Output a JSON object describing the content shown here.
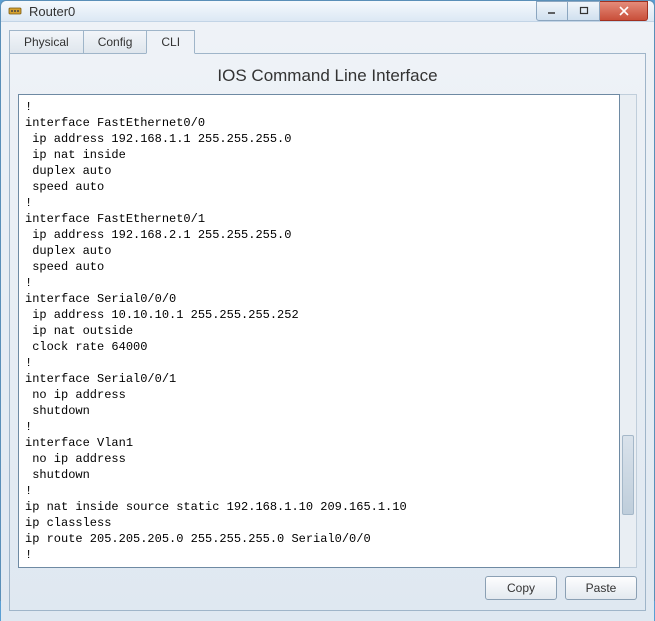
{
  "window": {
    "title": "Router0"
  },
  "tabs": {
    "items": [
      {
        "label": "Physical",
        "active": false
      },
      {
        "label": "Config",
        "active": false
      },
      {
        "label": "CLI",
        "active": true
      }
    ]
  },
  "cli": {
    "heading": "IOS Command Line Interface",
    "lines": [
      "!",
      "interface FastEthernet0/0",
      " ip address 192.168.1.1 255.255.255.0",
      " ip nat inside",
      " duplex auto",
      " speed auto",
      "!",
      "interface FastEthernet0/1",
      " ip address 192.168.2.1 255.255.255.0",
      " duplex auto",
      " speed auto",
      "!",
      "interface Serial0/0/0",
      " ip address 10.10.10.1 255.255.255.252",
      " ip nat outside",
      " clock rate 64000",
      "!",
      "interface Serial0/0/1",
      " no ip address",
      " shutdown",
      "!",
      "interface Vlan1",
      " no ip address",
      " shutdown",
      "!",
      "ip nat inside source static 192.168.1.10 209.165.1.10",
      "ip classless",
      "ip route 205.205.205.0 255.255.255.0 Serial0/0/0",
      "!"
    ]
  },
  "buttons": {
    "copy": "Copy",
    "paste": "Paste"
  }
}
